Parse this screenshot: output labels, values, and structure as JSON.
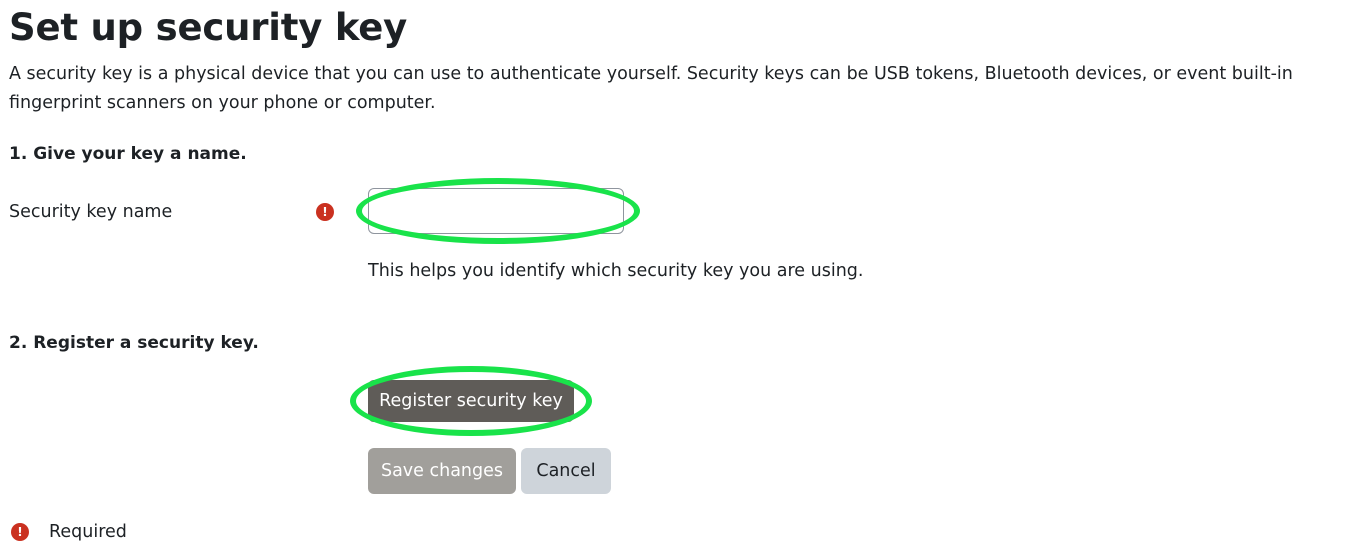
{
  "page": {
    "title": "Set up security key",
    "intro": "A security key is a physical device that you can use to authenticate yourself. Security keys can be USB tokens, Bluetooth devices, or event built-in fingerprint scanners on your phone or computer."
  },
  "step1": {
    "heading": "1. Give your key a name.",
    "field_label": "Security key name",
    "required_icon": "!",
    "input_value": "",
    "help_text": "This helps you identify which security key you are using."
  },
  "step2": {
    "heading": "2. Register a security key.",
    "register_button": "Register security key"
  },
  "actions": {
    "save_label": "Save changes",
    "cancel_label": "Cancel"
  },
  "legend": {
    "icon": "!",
    "required_label": "Required"
  },
  "colors": {
    "highlight": "#19e34a",
    "required_icon": "#ca3120",
    "register_button": "#5f5c58",
    "save_button": "#a19f9b",
    "cancel_button": "#ced4da"
  },
  "icons": {
    "required": "exclamation-circle-icon"
  }
}
